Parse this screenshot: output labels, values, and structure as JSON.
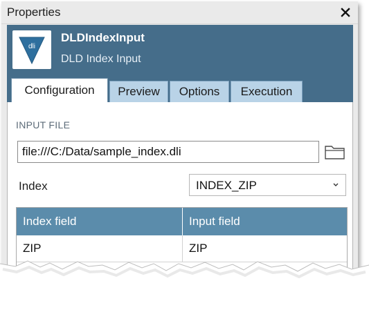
{
  "window": {
    "title": "Properties",
    "close_icon": "close-icon"
  },
  "component": {
    "icon_text": "dli",
    "name": "DLDIndexInput",
    "description": "DLD Index Input"
  },
  "tabs": [
    {
      "label": "Configuration",
      "active": true
    },
    {
      "label": "Preview",
      "active": false
    },
    {
      "label": "Options",
      "active": false
    },
    {
      "label": "Execution",
      "active": false
    }
  ],
  "config": {
    "input_file_label": "INPUT FILE",
    "input_file_value": "file:///C:/Data/sample_index.dli",
    "folder_icon": "folder-icon",
    "index_label": "Index",
    "index_selected": "INDEX_ZIP",
    "index_chevron": "chevron-down-icon"
  },
  "table": {
    "columns": [
      "Index field",
      "Input field"
    ],
    "rows": [
      [
        "ZIP",
        "ZIP"
      ]
    ]
  },
  "colors": {
    "header_band": "#456d8a",
    "tab_inactive": "#b9d3e7",
    "table_header": "#5b8cab"
  }
}
